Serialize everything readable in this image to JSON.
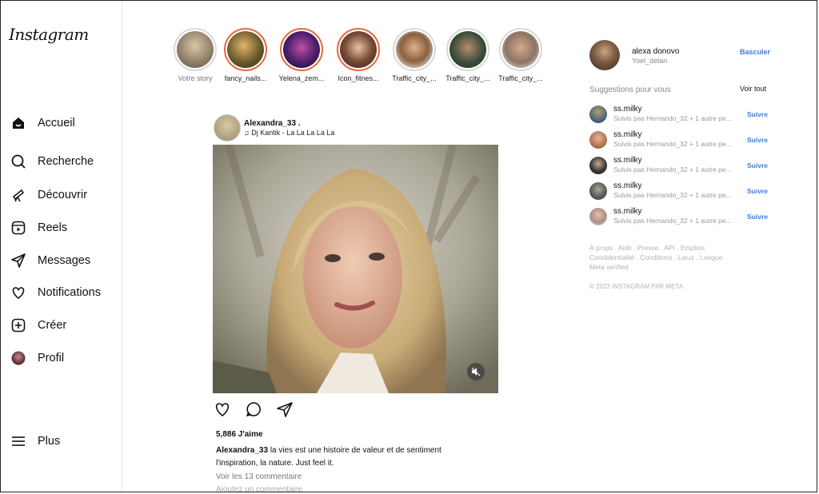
{
  "app": {
    "logo": "Instagram"
  },
  "sidebar": {
    "items": [
      {
        "label": "Accueil",
        "icon": "home-icon"
      },
      {
        "label": "Recherche",
        "icon": "search-icon"
      },
      {
        "label": "Découvrir",
        "icon": "explore-icon"
      },
      {
        "label": "Reels",
        "icon": "reels-icon"
      },
      {
        "label": "Messages",
        "icon": "messages-icon"
      },
      {
        "label": "Notifications",
        "icon": "heart-icon"
      },
      {
        "label": "Créer",
        "icon": "create-icon"
      },
      {
        "label": "Profil",
        "icon": "profile-avatar"
      }
    ],
    "more": {
      "label": "Plus",
      "icon": "menu-icon"
    }
  },
  "stories": [
    {
      "label": "Votre story",
      "ring": "none"
    },
    {
      "label": "fancy_nails...",
      "ring": "new"
    },
    {
      "label": "Yelena_zem...",
      "ring": "new"
    },
    {
      "label": "Icon_fitnes...",
      "ring": "new"
    },
    {
      "label": "Traffic_city_...",
      "ring": "seen"
    },
    {
      "label": "Traffic_city_...",
      "ring": "seen"
    },
    {
      "label": "Traffic_city_...",
      "ring": "seen"
    }
  ],
  "post": {
    "username": "Alexandra_33 .",
    "music": "Dj Kantik - La La La La La",
    "likes": "5,886 J'aime",
    "caption_user": "Alexandra_33",
    "caption_line1": "la vies est une histoire de valeur et de sentiment",
    "caption_line2": "l'inspiration, la nature. Just feel it.",
    "view_comments": "Voir les 13 commentaire",
    "add_comment": "Ajoutez un commentaire"
  },
  "profile": {
    "name": "alexa donovo",
    "handle": "Yoel_delan",
    "switch_label": "Basculer"
  },
  "suggestions": {
    "title": "Suggestions pour vous",
    "see_all": "Voir tout",
    "items": [
      {
        "name": "ss.milky",
        "sub": "Suivis pas Hernando_32 + 1 autre pe...",
        "follow": "Suivre"
      },
      {
        "name": "ss.milky",
        "sub": "Suivis pas Hernando_32 + 1 autre pe...",
        "follow": "Suivre"
      },
      {
        "name": "ss.milky",
        "sub": "Suivis pas Hernando_32 + 1 autre pe...",
        "follow": "Suivre"
      },
      {
        "name": "ss.milky",
        "sub": "Suivis pas Hernando_32 + 1 autre pe...",
        "follow": "Suivre"
      },
      {
        "name": "ss.milky",
        "sub": "Suivis pas Hernando_32 + 1 autre pe...",
        "follow": "Suivre"
      }
    ]
  },
  "footer": {
    "line1": "À props . Aide . Presse . API . Emplois",
    "line2": "Condidentialité . Conditions . Lieux . Langue",
    "line3": "Meta verified",
    "copyright": "© 2023 INSTAGRAM PAR META"
  },
  "colors": {
    "accent": "#3e7bd6",
    "story_ring_new": "#e8693f",
    "story_ring_seen": "#d9d9d9"
  }
}
